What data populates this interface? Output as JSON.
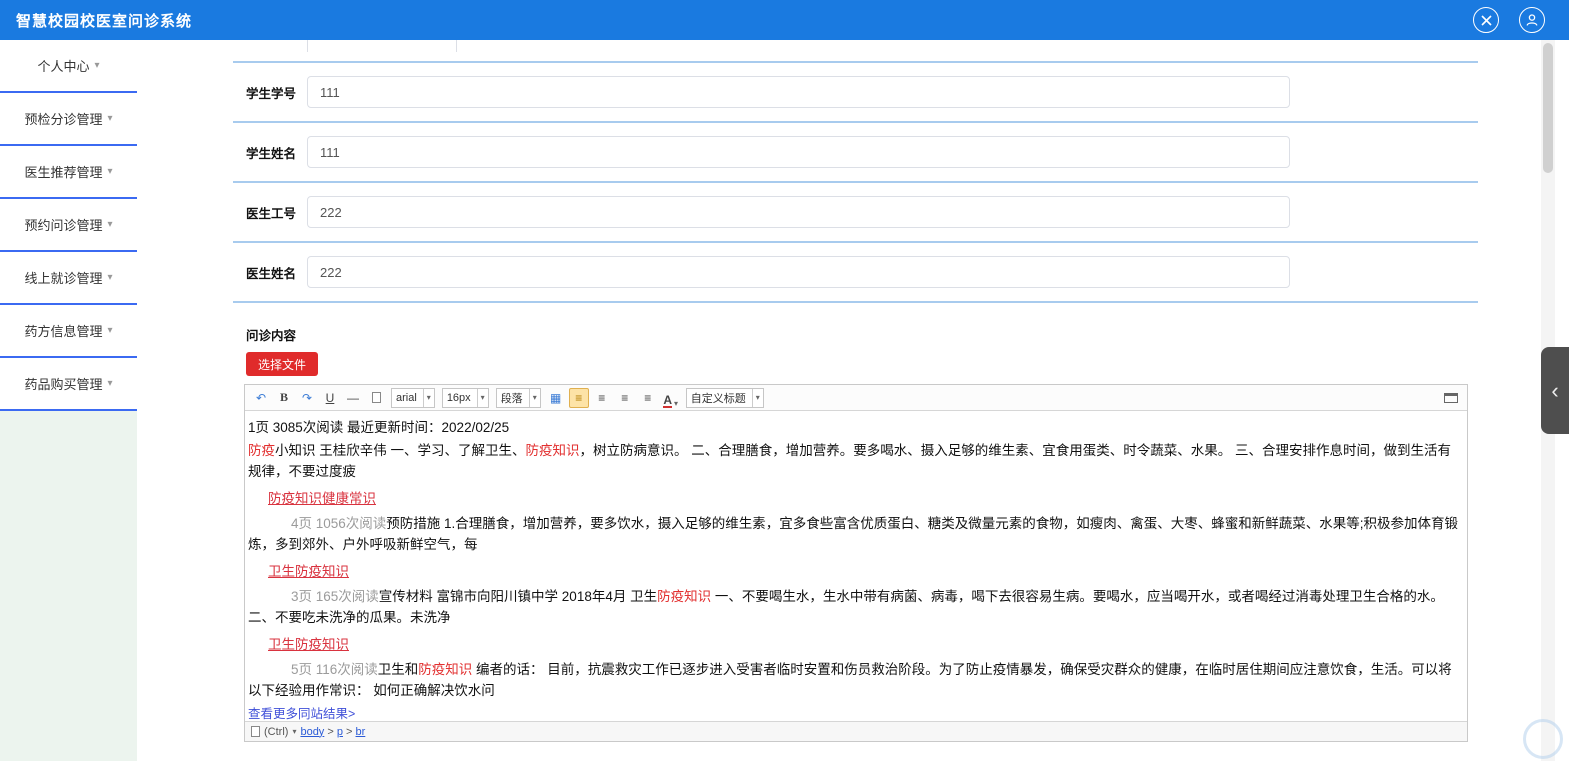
{
  "colors": {
    "topbar_bg": "#1a7ae0",
    "sidebar_divider": "#3b6af2",
    "sidebar_footer_bg": "#ecf4ee",
    "row_divider": "#a8cbee",
    "file_button_bg": "#e02b2b",
    "red_text": "#e23030",
    "red_link": "#d9333f",
    "gray_text": "#9b9b9b",
    "blue_link": "#3f4fd8",
    "toolbar_active_bg": "#fde3a7"
  },
  "topbar": {
    "title": "智慧校园校医室问诊系统"
  },
  "sidebar": {
    "caret": "▾",
    "items": [
      {
        "label": "个人中心"
      },
      {
        "label": "预检分诊管理"
      },
      {
        "label": "医生推荐管理"
      },
      {
        "label": "预约问诊管理"
      },
      {
        "label": "线上就诊管理"
      },
      {
        "label": "药方信息管理"
      },
      {
        "label": "药品购买管理"
      }
    ]
  },
  "form": {
    "fields": [
      {
        "label": "学生学号",
        "value": "111"
      },
      {
        "label": "学生姓名",
        "value": "111"
      },
      {
        "label": "医生工号",
        "value": "222"
      },
      {
        "label": "医生姓名",
        "value": "222"
      }
    ],
    "content_label": "问诊内容",
    "file_button_label": "选择文件"
  },
  "editor": {
    "toolbar": {
      "font_family": "arial",
      "font_size": "16px",
      "paragraph": "段落",
      "custom_title": "自定义标题",
      "bold": "B",
      "underline": "U",
      "strike": "—",
      "color_letter": "A",
      "icons": {
        "undo": "↶",
        "redo": "↷",
        "table": "▦",
        "align": "≡",
        "caret": "▾"
      }
    },
    "paragraphs": [
      {
        "style": "plain",
        "segments": [
          {
            "text": "1页  3085次阅读 最近更新时间：2022/02/25",
            "type": "plain"
          }
        ]
      },
      {
        "style": "plain",
        "segments": [
          {
            "text": "防疫",
            "type": "red"
          },
          {
            "text": "小知识 王桂欣辛伟 一、学习、了解卫生、",
            "type": "plain"
          },
          {
            "text": "防疫知识",
            "type": "red"
          },
          {
            "text": "，树立防病意识。 二、合理膳食，增加营养。要多喝水、摄入足够的维生素、宜食用蛋类、时令蔬菜、水果。 三、合理安排作息时间，做到生活有规律，不要过度疲",
            "type": "plain"
          }
        ]
      },
      {
        "style": "link-row",
        "segments": [
          {
            "text": "防疫知识健康常识",
            "type": "red-link"
          }
        ]
      },
      {
        "style": "indent",
        "segments": [
          {
            "text": "4页    1056次阅读",
            "type": "gray"
          },
          {
            "text": "预防措施 1.合理膳食，增加营养，要多饮水，摄入足够的维生素，宜多食些富含优质蛋白、糖类及微量元素的食物，如瘦肉、禽蛋、大枣、蜂蜜和新鲜蔬菜、水果等;积极参加体育锻炼，多到郊外、户外呼吸新鲜空气，每",
            "type": "plain"
          }
        ]
      },
      {
        "style": "link-row",
        "segments": [
          {
            "text": "卫生防疫知识",
            "type": "red-link"
          }
        ]
      },
      {
        "style": "indent",
        "segments": [
          {
            "text": "3页    165次阅读",
            "type": "gray"
          },
          {
            "text": "宣传材料 富锦市向阳川镇中学 2018年4月 卫生",
            "type": "plain"
          },
          {
            "text": "防疫知识",
            "type": "red"
          },
          {
            "text": " 一、不要喝生水，生水中带有病菌、病毒，喝下去很容易生病。要喝水，应当喝开水，或者喝经过消毒处理卫生合格的水。二、不要吃未洗净的瓜果。未洗净",
            "type": "plain"
          }
        ]
      },
      {
        "style": "link-row",
        "segments": [
          {
            "text": "卫生防疫知识",
            "type": "red-link"
          }
        ]
      },
      {
        "style": "indent",
        "segments": [
          {
            "text": "5页    116次阅读",
            "type": "gray"
          },
          {
            "text": "卫生和",
            "type": "plain"
          },
          {
            "text": "防疫知识",
            "type": "red"
          },
          {
            "text": " 编者的话： 目前，抗震救灾工作已逐步进入受害者临时安置和伤员救治阶段。为了防止疫情暴发，确保受灾群众的健康，在临时居住期间应注意饮食，生活。可以将以下经验用作常识： 如何正确解决饮水问",
            "type": "plain"
          }
        ]
      },
      {
        "style": "plain",
        "segments": [
          {
            "text": "查看更多同站结果>",
            "type": "blue-link"
          }
        ]
      },
      {
        "style": "plain",
        "segments": [
          {
            "text": "|",
            "type": "plain"
          }
        ]
      }
    ],
    "statusbar": {
      "ctrl_hint": "(Ctrl)",
      "caret": "▾",
      "path": [
        "body",
        "p",
        "br"
      ],
      "path_separator": " > "
    }
  },
  "right_panel": {
    "chevron": "‹"
  }
}
